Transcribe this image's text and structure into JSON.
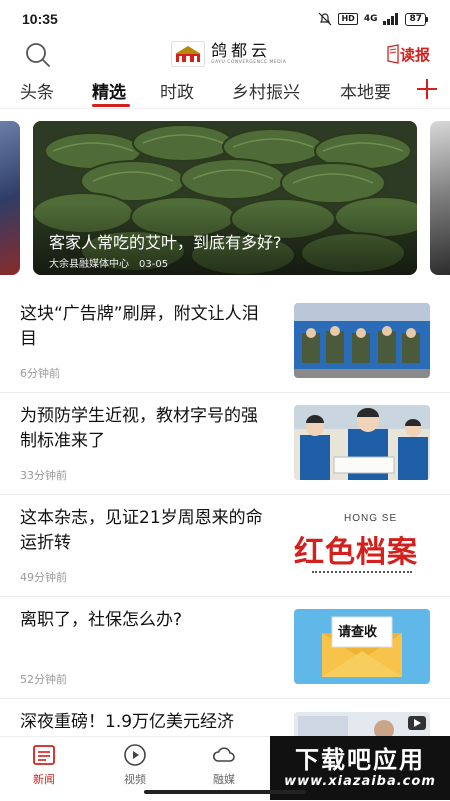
{
  "status_bar": {
    "time": "10:35",
    "hd": "HD",
    "network": "4G",
    "battery": "87"
  },
  "header": {
    "logo_text": "鸽都云",
    "logo_subtitle": "GAYU CONVERGENCE MEDIA",
    "read_paper_label": "读报"
  },
  "tabs": [
    {
      "label": "头条",
      "active": false
    },
    {
      "label": "精选",
      "active": true
    },
    {
      "label": "时政",
      "active": false
    },
    {
      "label": "乡村振兴",
      "active": false
    },
    {
      "label": "本地要",
      "active": false
    }
  ],
  "banner": {
    "title": "客家人常吃的艾叶，到底有多好?",
    "source": "大余县融媒体中心",
    "date": "03-05"
  },
  "news": [
    {
      "title": "这块“广告牌”刷屏，附文让人泪目",
      "time": "6分钟前"
    },
    {
      "title": "为预防学生近视，教材字号的强制标准来了",
      "time": "33分钟前"
    },
    {
      "title": "这本杂志，见证21岁周恩来的命运折转",
      "time": "49分钟前",
      "thumb_text_top": "HONG SE",
      "thumb_text_main": "红色档案"
    },
    {
      "title": "离职了，社保怎么办?",
      "time": "52分钟前",
      "thumb_label": "请查收"
    },
    {
      "title": "深夜重磅！1.9万亿美元经济",
      "time": ""
    }
  ],
  "bottom_nav": [
    {
      "label": "新闻",
      "icon": "list-icon",
      "active": true
    },
    {
      "label": "视频",
      "icon": "play-icon",
      "active": false
    },
    {
      "label": "融媒",
      "icon": "cloud-icon",
      "active": false
    }
  ],
  "watermark": {
    "main": "下载吧应用",
    "sub": "www.xiazaiba.com"
  },
  "colors": {
    "accent": "#d4201c",
    "text": "#1a1a1a",
    "muted": "#999999"
  }
}
